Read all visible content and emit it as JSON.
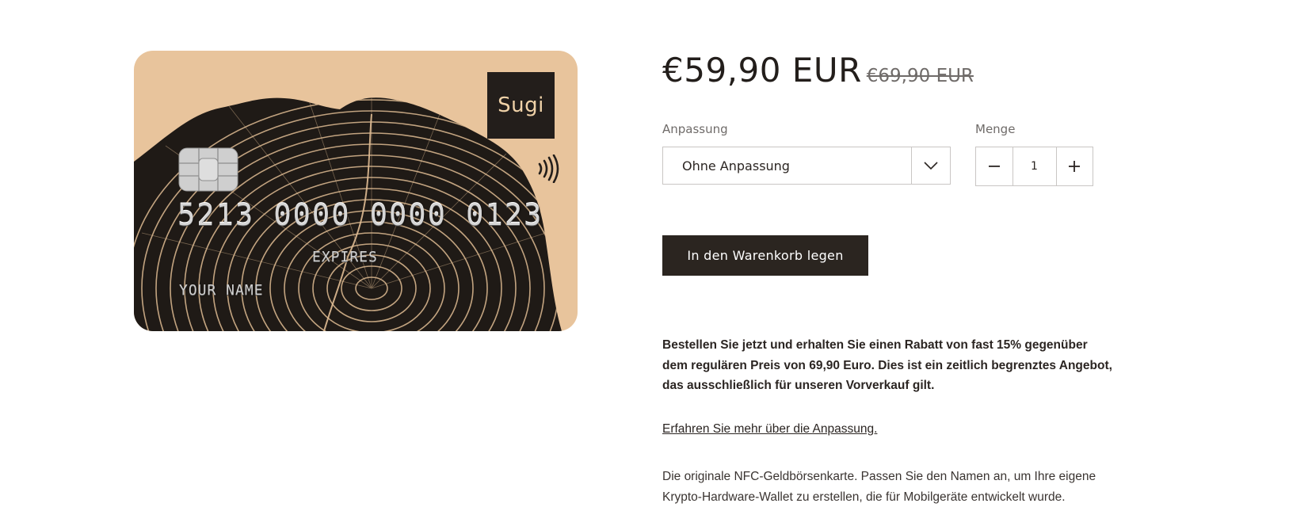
{
  "card": {
    "brand_logo_text": "Sugi",
    "number": "5213 0000 0000 0123",
    "expires_label": "EXPIRES",
    "name_label": "YOUR NAME",
    "background_color": "#e8c49c",
    "icons": [
      "chip-icon",
      "contactless-icon"
    ]
  },
  "product": {
    "price_current": "€59,90 EUR",
    "price_old": "€69,90 EUR",
    "adjust_label": "Anpassung",
    "adjust_selected": "Ohne Anpassung",
    "quantity_label": "Menge",
    "quantity_value": "1",
    "add_to_cart_label": "In den Warenkorb legen",
    "promo_text": "Bestellen Sie jetzt und erhalten Sie einen Rabatt von fast 15% gegenüber dem regulären Preis von 69,90 Euro. Dies ist ein zeitlich begrenztes Angebot, das ausschließlich für unseren Vorverkauf gilt.",
    "learn_more_link": "Erfahren Sie mehr über die Anpassung.",
    "description": "Die originale NFC-Geldbörsenkarte. Passen Sie den Namen an, um Ihre eigene Krypto-Hardware-Wallet zu erstellen, die für Mobilgeräte entwickelt wurde."
  },
  "colors": {
    "accent_dark": "#2b2520",
    "muted_text": "#6f6b69",
    "border": "#c9c6c4"
  }
}
